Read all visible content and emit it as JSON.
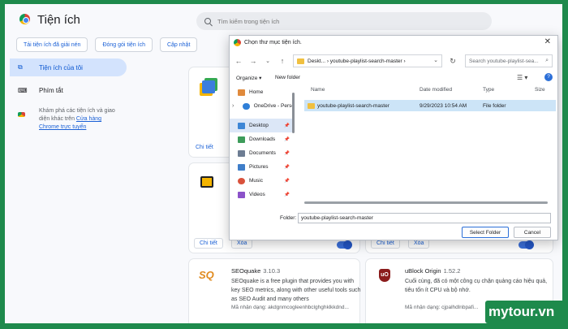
{
  "app": {
    "title": "Tiện ích"
  },
  "search": {
    "placeholder": "Tìm kiếm trong tiện ích"
  },
  "toolbar": {
    "load_unpacked": "Tải tiện ích đã giải nén",
    "pack": "Đóng gói tiện ích",
    "update": "Cập nhật"
  },
  "sidebar": {
    "items": [
      {
        "label": "Tiện ích của tôi",
        "icon": "puzzle-icon"
      },
      {
        "label": "Phím tắt",
        "icon": "keyboard-icon"
      }
    ],
    "note_text": "Khám phá các tiện ích và giao diện khác trên ",
    "note_link": "Cửa hàng Chrome trực tuyến"
  },
  "cards": {
    "details_label": "Chi tiết",
    "remove_label": "Xóa",
    "seo": {
      "name": "SEOquake",
      "version": "3.10.3",
      "desc": "SEOquake is a free plugin that provides you with key SEO metrics, along with other useful tools such as SEO Audit and many others",
      "id": "Mã nhận dạng: akdgnmcogleenhbclghghklkkdnd..."
    },
    "ublock": {
      "name": "uBlock Origin",
      "version": "1.52.2",
      "desc": "Cuối cùng, đã có một công cụ chặn quảng cáo hiệu quả, tiêu tốn ít CPU và bộ nhớ.",
      "id": "Mã nhận dạng: cjpalhdlnbpafi..."
    }
  },
  "dialog": {
    "title": "Chọn thư mục tiện ích.",
    "address": "Deskt...  ›  youtube-playlist-search-master  ›",
    "search_placeholder": "Search youtube-playlist-sea...",
    "organize": "Organize ▾",
    "new_folder": "New folder",
    "nav_items": [
      {
        "label": "Home",
        "icon": "home-icon",
        "color": "#e08a3c"
      },
      {
        "label": "OneDrive - Perso",
        "icon": "cloud-icon",
        "color": "#2f7fd8"
      },
      {
        "label": "Desktop",
        "icon": "desktop-icon",
        "color": "#3d86d6"
      },
      {
        "label": "Downloads",
        "icon": "download-icon",
        "color": "#3d9c5a"
      },
      {
        "label": "Documents",
        "icon": "documents-icon",
        "color": "#6d7d93"
      },
      {
        "label": "Pictures",
        "icon": "pictures-icon",
        "color": "#3f7ec9"
      },
      {
        "label": "Music",
        "icon": "music-icon",
        "color": "#d9523c"
      },
      {
        "label": "Videos",
        "icon": "videos-icon",
        "color": "#8b52c9"
      }
    ],
    "columns": {
      "name": "Name",
      "date": "Date modified",
      "type": "Type",
      "size": "Size"
    },
    "file": {
      "name": "youtube-playlist-search-master",
      "date": "9/29/2023 10:54 AM",
      "type": "File folder"
    },
    "folder_label": "Folder:",
    "folder_value": "youtube-playlist-search-master",
    "select_label": "Select Folder",
    "cancel_label": "Cancel"
  },
  "watermark": "mytour.vn"
}
